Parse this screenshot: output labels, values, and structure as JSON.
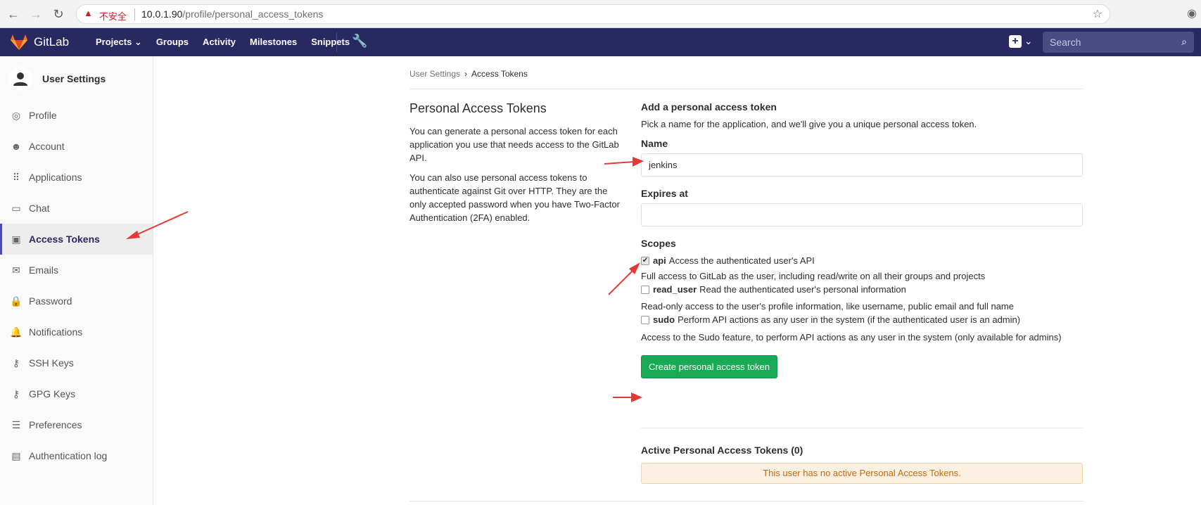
{
  "browser": {
    "insecure_label": "不安全",
    "url_host": "10.0.1.90",
    "url_path": "/profile/personal_access_tokens"
  },
  "navbar": {
    "brand": "GitLab",
    "links": [
      "Projects ⌄",
      "Groups",
      "Activity",
      "Milestones",
      "Snippets"
    ],
    "search_placeholder": "Search",
    "bg_color": "#292961"
  },
  "sidebar": {
    "title": "User Settings",
    "items": [
      {
        "label": "Profile",
        "icon": "profile-icon"
      },
      {
        "label": "Account",
        "icon": "account-icon"
      },
      {
        "label": "Applications",
        "icon": "applications-icon"
      },
      {
        "label": "Chat",
        "icon": "chat-icon"
      },
      {
        "label": "Access Tokens",
        "icon": "token-icon",
        "active": true
      },
      {
        "label": "Emails",
        "icon": "email-icon"
      },
      {
        "label": "Password",
        "icon": "lock-icon"
      },
      {
        "label": "Notifications",
        "icon": "bell-icon"
      },
      {
        "label": "SSH Keys",
        "icon": "key-icon"
      },
      {
        "label": "GPG Keys",
        "icon": "key-icon"
      },
      {
        "label": "Preferences",
        "icon": "sliders-icon"
      },
      {
        "label": "Authentication log",
        "icon": "log-icon"
      }
    ]
  },
  "breadcrumb": {
    "parent": "User Settings",
    "current": "Access Tokens"
  },
  "intro": {
    "title": "Personal Access Tokens",
    "p1": "You can generate a personal access token for each application you use that needs access to the GitLab API.",
    "p2": "You can also use personal access tokens to authenticate against Git over HTTP. They are the only accepted password when you have Two-Factor Authentication (2FA) enabled."
  },
  "form": {
    "heading": "Add a personal access token",
    "subheading": "Pick a name for the application, and we'll give you a unique personal access token.",
    "name_label": "Name",
    "name_value": "jenkins",
    "expires_label": "Expires at",
    "expires_value": "",
    "scopes_label": "Scopes",
    "scopes": [
      {
        "name": "api",
        "desc": "Access the authenticated user's API",
        "help": "Full access to GitLab as the user, including read/write on all their groups and projects",
        "checked": true
      },
      {
        "name": "read_user",
        "desc": "Read the authenticated user's personal information",
        "help": "Read-only access to the user's profile information, like username, public email and full name",
        "checked": false
      },
      {
        "name": "sudo",
        "desc": "Perform API actions as any user in the system (if the authenticated user is an admin)",
        "help": "Access to the Sudo feature, to perform API actions as any user in the system (only available for admins)",
        "checked": false
      }
    ],
    "submit_label": "Create personal access token"
  },
  "active_tokens": {
    "heading": "Active Personal Access Tokens (0)",
    "empty_message": "This user has no active Personal Access Tokens."
  },
  "colors": {
    "accent_green": "#1aaa55",
    "annotation_red": "#e53935",
    "warning_bg": "#fcf1e1"
  }
}
